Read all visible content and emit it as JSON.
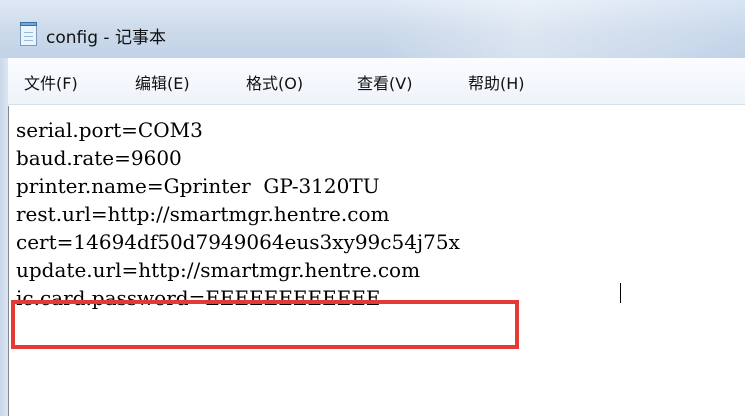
{
  "window": {
    "title": "config - 记事本",
    "icon": "notepad-icon"
  },
  "menu": [
    {
      "label": "文件(F)"
    },
    {
      "label": "编辑(E)"
    },
    {
      "label": "格式(O)"
    },
    {
      "label": "查看(V)"
    },
    {
      "label": "帮助(H)"
    }
  ],
  "editor": {
    "lines": [
      "serial.port=COM3",
      "baud.rate=9600",
      "printer.name=Gprinter  GP-3120TU",
      "rest.url=http://smartmgr.hentre.com",
      "cert=14694df50d7949064eus3xy99c54j75x",
      "update.url=http://smartmgr.hentre.com",
      "ic.card.password=EEEEEEEEEEEE"
    ]
  },
  "annotation": {
    "highlight_color": "#e53935"
  }
}
